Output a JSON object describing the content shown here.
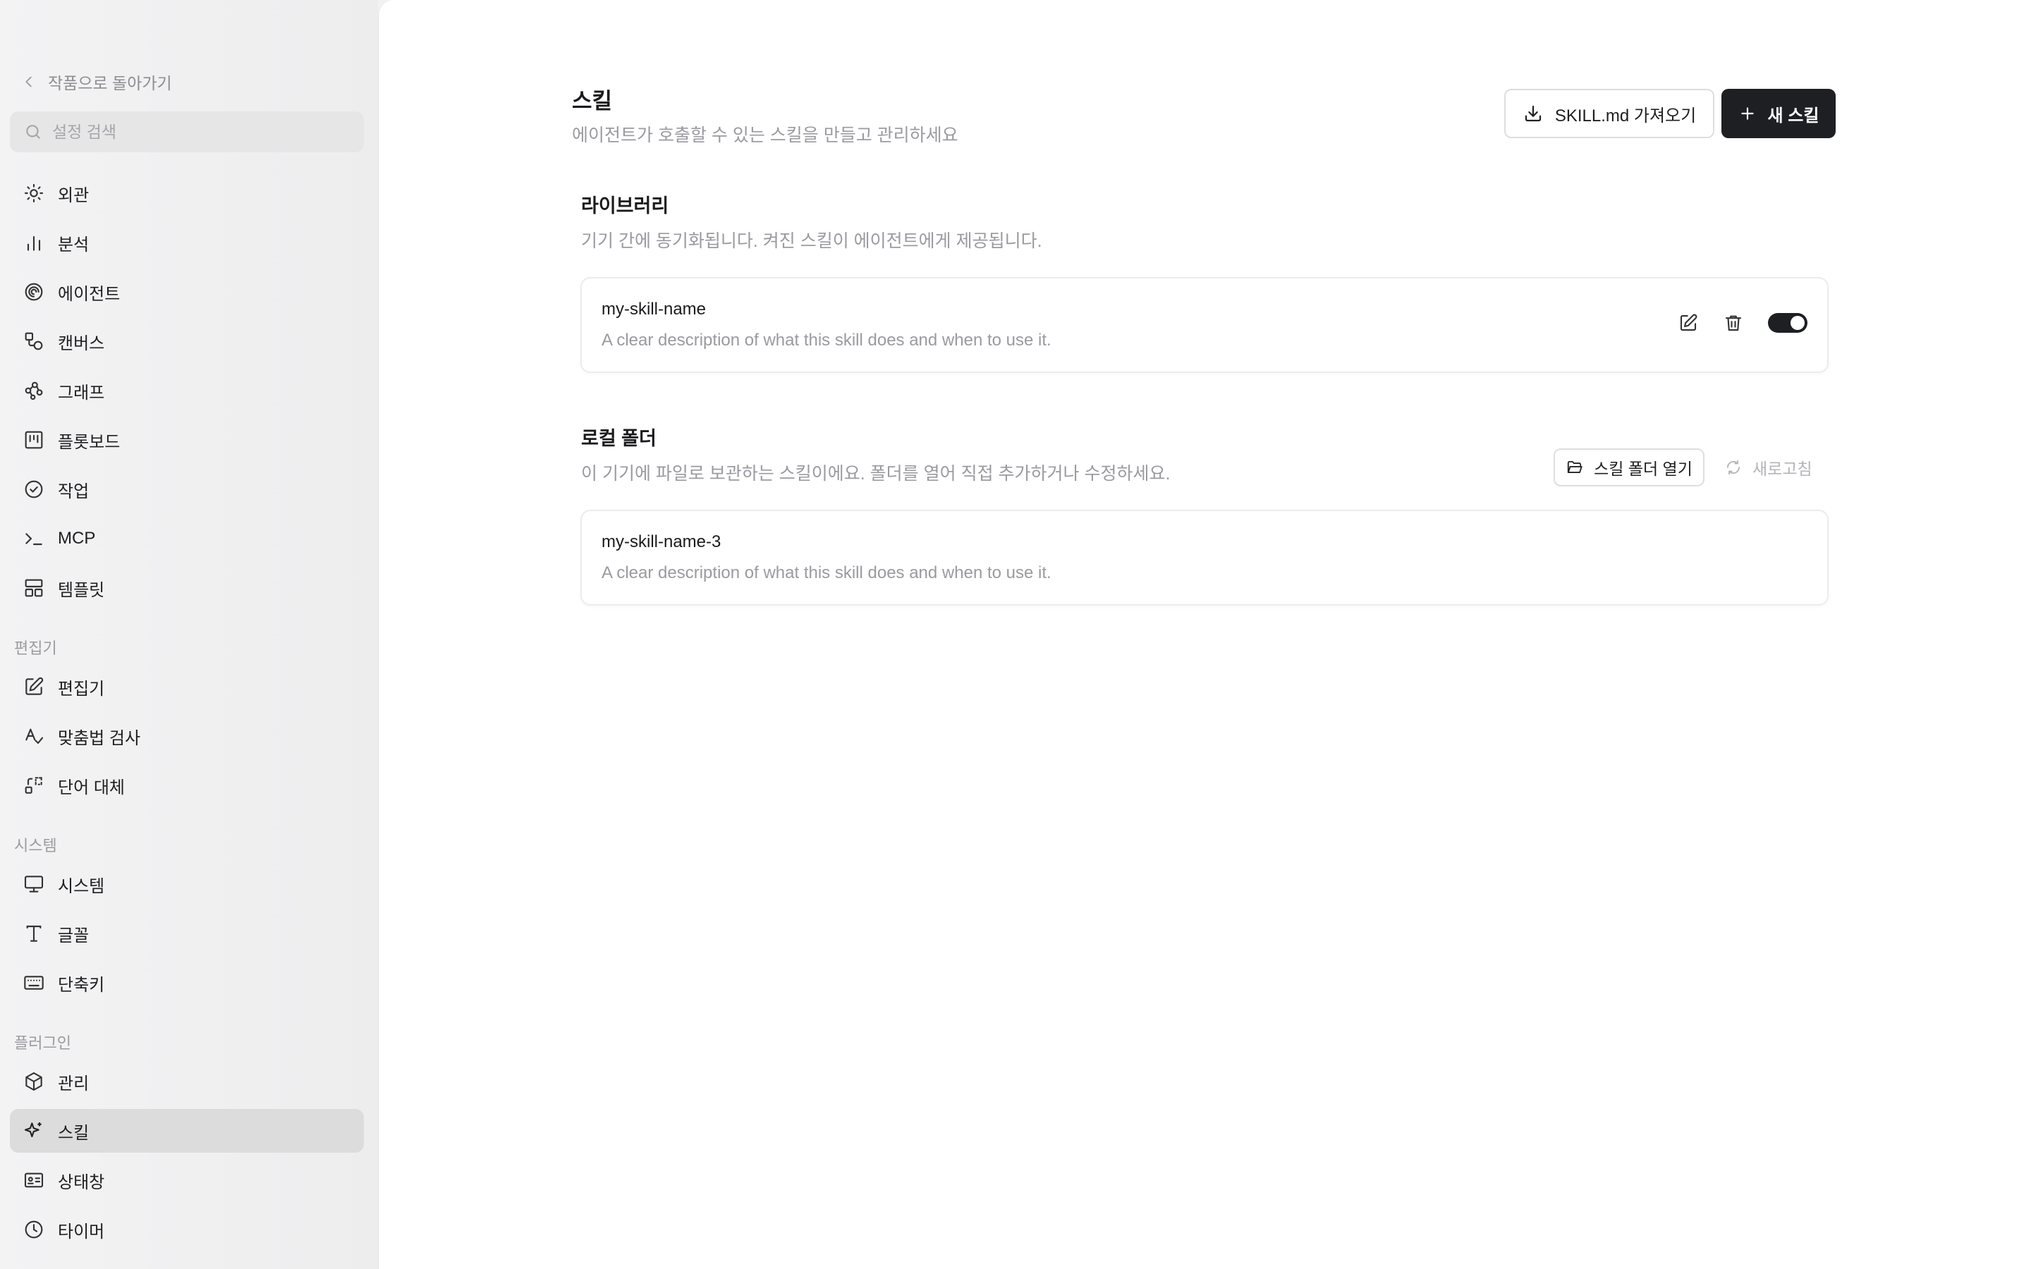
{
  "sidebar": {
    "back_label": "작품으로 돌아가기",
    "search_placeholder": "설정 검색",
    "items_top": [
      {
        "label": "외관",
        "icon": "sun-icon"
      },
      {
        "label": "분석",
        "icon": "bar-chart-icon"
      },
      {
        "label": "에이전트",
        "icon": "spiral-icon"
      },
      {
        "label": "캔버스",
        "icon": "shapes-icon"
      },
      {
        "label": "그래프",
        "icon": "graph-nodes-icon"
      },
      {
        "label": "플롯보드",
        "icon": "kanban-icon"
      },
      {
        "label": "작업",
        "icon": "check-circle-icon"
      },
      {
        "label": "MCP",
        "icon": "terminal-icon"
      },
      {
        "label": "템플릿",
        "icon": "layout-template-icon"
      }
    ],
    "section_editor": "편집기",
    "items_editor": [
      {
        "label": "편집기",
        "icon": "edit-square-icon"
      },
      {
        "label": "맞춤법 검사",
        "icon": "spellcheck-icon"
      },
      {
        "label": "단어 대체",
        "icon": "replace-icon"
      }
    ],
    "section_system": "시스템",
    "items_system": [
      {
        "label": "시스템",
        "icon": "monitor-icon"
      },
      {
        "label": "글꼴",
        "icon": "type-icon"
      },
      {
        "label": "단축키",
        "icon": "keyboard-icon"
      }
    ],
    "section_plugins": "플러그인",
    "items_plugins": [
      {
        "label": "관리",
        "icon": "package-icon"
      },
      {
        "label": "스킬",
        "icon": "sparkles-icon",
        "active": true
      },
      {
        "label": "상태창",
        "icon": "id-card-icon"
      },
      {
        "label": "타이머",
        "icon": "clock-icon"
      }
    ]
  },
  "main": {
    "title": "스킬",
    "description": "에이전트가 호출할 수 있는 스킬을 만들고 관리하세요",
    "import_label": "SKILL.md 가져오기",
    "new_label": "새 스킬",
    "library": {
      "title": "라이브러리",
      "description": "기기 간에 동기화됩니다. 켜진 스킬이 에이전트에게 제공됩니다.",
      "skill": {
        "name": "my-skill-name",
        "description": "A clear description of what this skill does and when to use it.",
        "enabled": true
      }
    },
    "local": {
      "title": "로컬 폴더",
      "description": "이 기기에 파일로 보관하는 스킬이에요. 폴더를 열어 직접 추가하거나 수정하세요.",
      "open_folder_label": "스킬 폴더 열기",
      "refresh_label": "새로고침",
      "skill": {
        "name": "my-skill-name-3",
        "description": "A clear description of what this skill does and when to use it."
      }
    }
  },
  "colors": {
    "primary_button": "#1d1f23",
    "muted_text": "#9a9aa0",
    "sidebar_active": "#dcdcdd"
  }
}
